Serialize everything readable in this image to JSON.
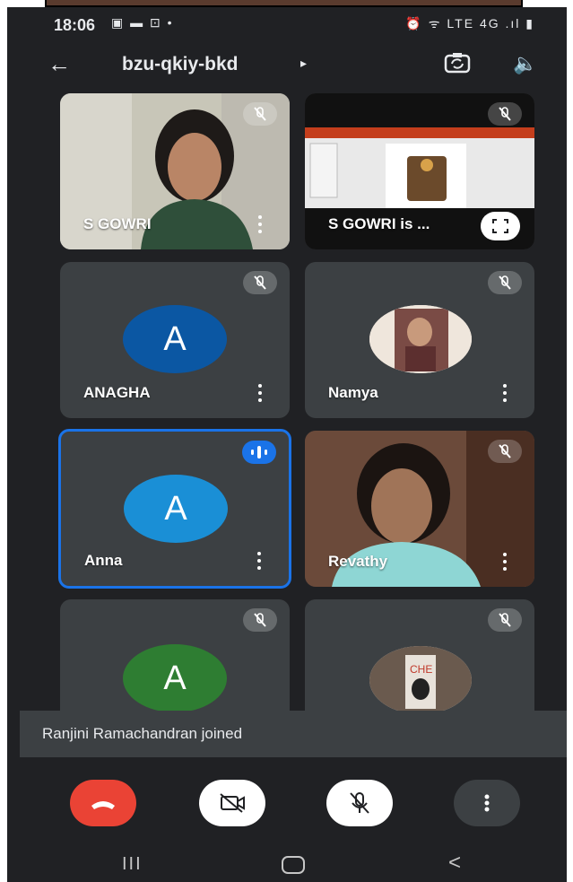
{
  "status_bar": {
    "time": "18:06",
    "left_icons": "▣ ▬ ⊡ •",
    "right_icons": "⏰ ᯤ LTE 4G .ıl ▮"
  },
  "app_bar": {
    "back_icon": "←",
    "meeting_code": "bzu-qkiy-bkd",
    "caret": "▸",
    "speaker_icon": "🔈"
  },
  "tiles": [
    {
      "name": "S GOWRI",
      "kind": "video",
      "muted": true
    },
    {
      "name": "S GOWRI is ...",
      "kind": "presentation",
      "muted": true
    },
    {
      "name": "ANAGHA",
      "kind": "avatar",
      "initial": "A",
      "color": "#0b57a3",
      "muted": true
    },
    {
      "name": "Namya",
      "kind": "photo",
      "muted": true
    },
    {
      "name": "Anna",
      "kind": "avatar",
      "initial": "A",
      "color": "#1a8fd6",
      "speaking": true
    },
    {
      "name": "Revathy",
      "kind": "video",
      "muted": true
    },
    {
      "name": "",
      "kind": "avatar",
      "initial": "A",
      "color": "#2e7d32",
      "muted": true
    },
    {
      "name": "",
      "kind": "photo",
      "muted": true
    }
  ],
  "toast": {
    "message": "Ranjini Ramachandran joined"
  },
  "colors": {
    "background": "#202124",
    "tile": "#3c4043",
    "active_border": "#1a73e8",
    "end_call": "#ea4335"
  },
  "nav": {
    "recents": "III",
    "back": "<"
  }
}
